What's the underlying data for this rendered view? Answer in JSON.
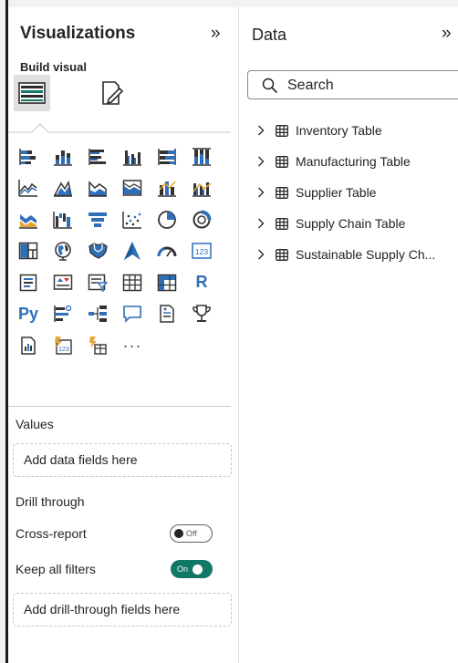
{
  "visualizations": {
    "title": "Visualizations",
    "collapse_glyph": "»",
    "build_visual_label": "Build visual",
    "build_tabs": [
      {
        "icon": "build-visual-icon",
        "selected": true
      },
      {
        "icon": "format-visual-icon",
        "selected": false
      }
    ],
    "visual_types": [
      [
        "stacked-bar-chart-icon",
        "stacked-column-chart-icon",
        "clustered-bar-chart-icon",
        "clustered-column-chart-icon",
        "100-stacked-bar-chart-icon",
        "100-stacked-column-chart-icon"
      ],
      [
        "line-chart-icon",
        "area-chart-icon",
        "stacked-area-chart-icon",
        "100-stacked-area-chart-icon",
        "line-and-stacked-column-chart-icon",
        "line-and-clustered-column-chart-icon"
      ],
      [
        "ribbon-chart-icon",
        "waterfall-chart-icon",
        "funnel-chart-icon",
        "scatter-chart-icon",
        "pie-chart-icon",
        "donut-chart-icon"
      ],
      [
        "treemap-icon",
        "map-icon",
        "filled-map-icon",
        "azure-map-icon",
        "gauge-icon",
        "card-icon"
      ],
      [
        "multi-row-card-icon",
        "kpi-icon",
        "slicer-icon",
        "table-icon",
        "matrix-icon",
        "r-script-visual-icon"
      ],
      [
        "python-visual-icon",
        "key-influencers-icon",
        "decomposition-tree-icon",
        "qa-icon",
        "smart-narrative-icon",
        "metrics-icon"
      ],
      [
        "paginated-report-icon",
        "power-apps-icon",
        "power-automate-icon",
        "more-visuals-icon"
      ]
    ],
    "r_label": "R",
    "py_label": "Py",
    "more_label": "···",
    "values_label": "Values",
    "values_placeholder": "Add data fields here",
    "drill_through_label": "Drill through",
    "cross_report_label": "Cross-report",
    "cross_report_toggle": "Off",
    "keep_filters_label": "Keep all filters",
    "keep_filters_toggle": "On",
    "drill_placeholder": "Add drill-through fields here"
  },
  "data": {
    "title": "Data",
    "collapse_glyph": "»",
    "search_placeholder": "Search",
    "tables": [
      {
        "label": "Inventory Table"
      },
      {
        "label": "Manufacturing Table"
      },
      {
        "label": "Supplier Table"
      },
      {
        "label": "Supply Chain Table"
      },
      {
        "label": "Sustainable Supply Ch..."
      }
    ]
  },
  "colors": {
    "accent_teal": "#117865",
    "chart_blue": "#2f6fb8",
    "chart_orange": "#e6a533",
    "chart_dark": "#3a3a3a",
    "pane_border": "#e1dfdd"
  }
}
